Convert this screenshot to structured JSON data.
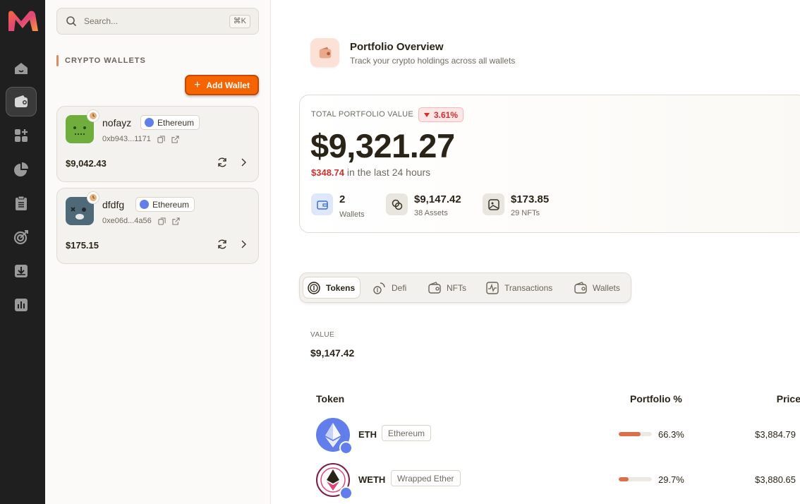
{
  "search": {
    "placeholder": "Search...",
    "shortcut": "⌘K"
  },
  "sidebar": {
    "section_label": "CRYPTO WALLETS",
    "add_wallet_label": "Add Wallet",
    "wallets": [
      {
        "name": "nofayz",
        "chain": "Ethereum",
        "address": "0xb943...1171",
        "balance": "$9,042.43",
        "avatar_color": "#6fae3c"
      },
      {
        "name": "dfdfg",
        "chain": "Ethereum",
        "address": "0xe06d...4a56",
        "balance": "$175.15",
        "avatar_color": "#4e6a78"
      }
    ]
  },
  "rail": {
    "icons": [
      "home-icon",
      "wallet-icon",
      "apps-icon",
      "pie-chart-icon",
      "clipboard-list-icon",
      "target-icon",
      "download-tray-icon",
      "bar-chart-icon"
    ],
    "active": "wallet-icon"
  },
  "overview": {
    "title": "Portfolio Overview",
    "subtitle": "Track your crypto holdings across all wallets"
  },
  "summary": {
    "label": "TOTAL PORTFOLIO VALUE",
    "change_pct": "3.61%",
    "total": "$9,321.27",
    "change_amount": "$348.74",
    "change_text": " in the last 24 hours",
    "stats": [
      {
        "value": "2",
        "label": "Wallets"
      },
      {
        "value": "$9,147.42",
        "label": "38 Assets"
      },
      {
        "value": "$173.85",
        "label": "29 NFTs"
      }
    ]
  },
  "tabs": [
    {
      "label": "Tokens",
      "icon": "coins-icon",
      "active": true
    },
    {
      "label": "Defi",
      "icon": "defi-icon",
      "active": false
    },
    {
      "label": "NFTs",
      "icon": "image-wallet-icon",
      "active": false
    },
    {
      "label": "Transactions",
      "icon": "activity-icon",
      "active": false
    },
    {
      "label": "Wallets",
      "icon": "wallet-icon",
      "active": false
    }
  ],
  "value_section": {
    "label": "VALUE",
    "value": "$9,147.42"
  },
  "table": {
    "headers": {
      "token": "Token",
      "portfolio": "Portfolio %",
      "price": "Price"
    },
    "rows": [
      {
        "symbol": "ETH",
        "name": "Ethereum",
        "portfolio_pct": "66.3%",
        "portfolio_fraction": 0.663,
        "price": "$3,884.79"
      },
      {
        "symbol": "WETH",
        "name": "Wrapped Ether",
        "portfolio_pct": "29.7%",
        "portfolio_fraction": 0.297,
        "price": "$3,880.65"
      }
    ]
  },
  "colors": {
    "accent": "#f56400",
    "negative": "#d32f2f",
    "rail_bg": "#1f1f1f",
    "eth": "#627eea",
    "bar_fill": "#db6f4c"
  }
}
